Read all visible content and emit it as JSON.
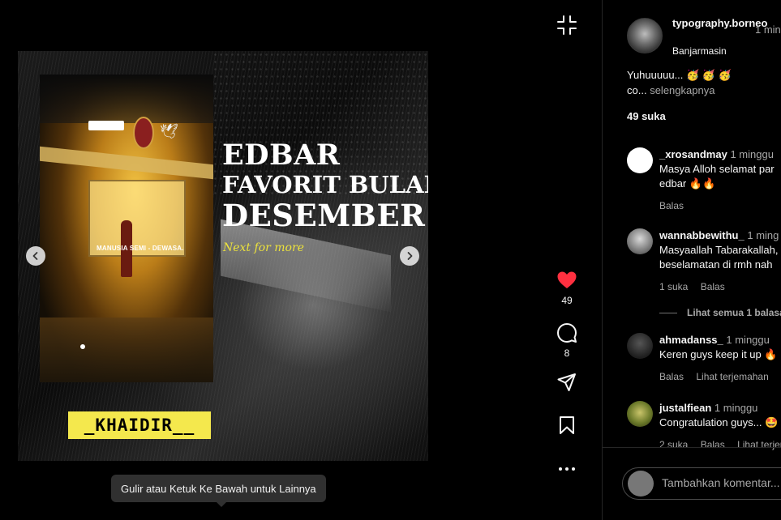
{
  "post": {
    "image": {
      "headline_1": "EDBAR",
      "headline_2": "FAVORIT BULAN",
      "headline_3": "DESEMBER",
      "subtext": "Next for more",
      "name_tag": "_KHAIDIR__",
      "photo_caption": "MANUSIA SEMI - DEWASA."
    },
    "tooltip": "Gulir atau Ketuk Ke Bawah untuk Lainnya"
  },
  "actions": {
    "likes": "49",
    "comments": "8"
  },
  "author": {
    "username": "typography.borneo",
    "time": "1 min",
    "location": "Banjarmasin"
  },
  "caption": {
    "line_1": "Yuhuuuuu... 🥳 🥳 🥳",
    "line_2": "co...",
    "more": "selengkapnya"
  },
  "likes_summary": "49 suka",
  "comments": [
    {
      "username": "_xrosandmay",
      "time": "1 minggu",
      "text_1": "Masya Alloh selamat par",
      "text_2": "edbar 🔥🔥",
      "reply": "Balas"
    },
    {
      "username": "wannabbewithu_",
      "time": "1 ming",
      "text_1": "Masyaallah Tabarakallah,",
      "text_2": "beselamatan di rmh nah",
      "likes": "1 suka",
      "reply": "Balas"
    },
    {
      "username": "ahmadanss_",
      "time": "1 minggu",
      "text_1": "Keren guys keep it up 🔥",
      "reply": "Balas",
      "translate": "Lihat terjemahan"
    },
    {
      "username": "justalfiean",
      "time": "1 minggu",
      "text_1": "Congratulation guys... 🤩",
      "likes": "2 suka",
      "reply": "Balas",
      "translate": "Lihat terjem"
    }
  ],
  "replies_toggle": "Lihat semua 1 balasan",
  "composer": {
    "placeholder": "Tambahkan komentar..."
  },
  "colors": {
    "like_red": "#ff3040",
    "name_bar_yellow": "#f4e84d",
    "subtext_yellow": "#ece23c",
    "background": "#000000",
    "muted_text": "#a8a8a8"
  },
  "icons": [
    "collapse-icon",
    "heart-icon",
    "comment-icon",
    "share-icon",
    "bookmark-icon",
    "more-icon",
    "chevron-left-icon",
    "chevron-right-icon"
  ]
}
